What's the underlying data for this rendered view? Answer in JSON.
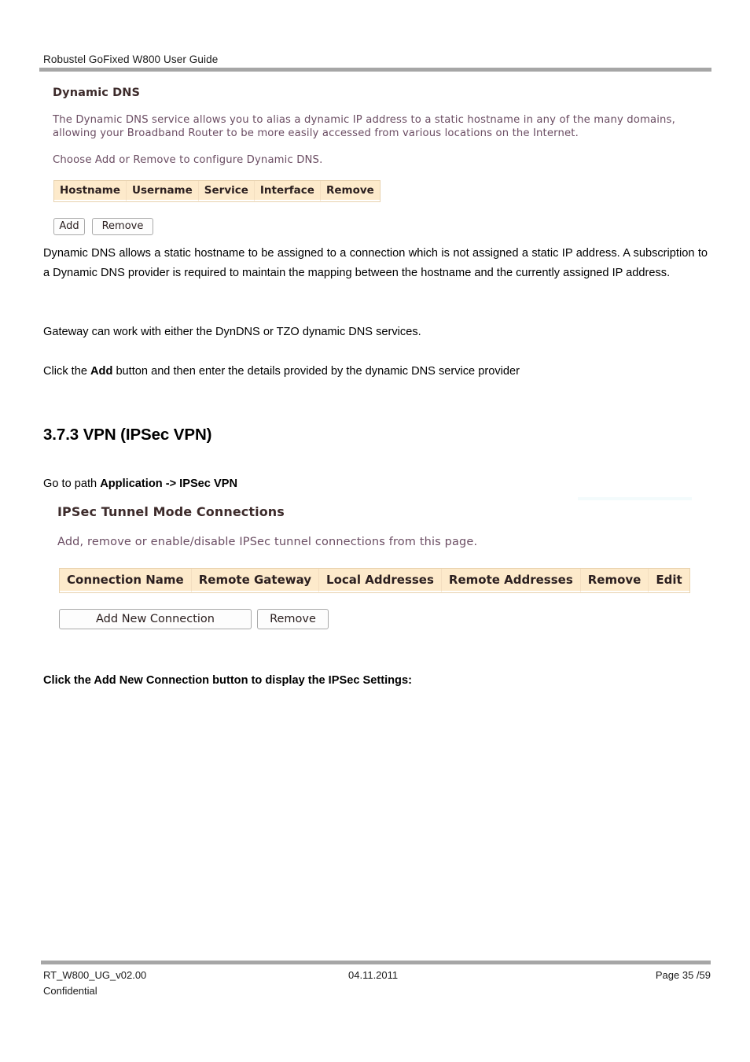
{
  "document": {
    "running_header": "Robustel GoFixed W800 User Guide"
  },
  "ddns_screenshot": {
    "title": "Dynamic DNS",
    "description_line1": "The Dynamic DNS service allows you to alias a dynamic IP address to a static hostname in any of the many domains,",
    "description_line2": "allowing your Broadband Router to be more easily accessed from various locations on the Internet.",
    "instruction": "Choose Add or Remove to configure Dynamic DNS.",
    "table_headers": [
      "Hostname",
      "Username",
      "Service",
      "Interface",
      "Remove"
    ],
    "buttons": [
      "Add",
      "Remove"
    ]
  },
  "body": {
    "paragraph_1_pre": "Dynamic DNS allows a static hostname to be assigned to a connection which is not assigned a static IP address. A subscription to a Dynamic DNS provider is required to maintain the mapping between the hostname and the currently assigned IP address.",
    "paragraph_2": "Gateway can work with either the DynDNS or TZO dynamic DNS services.",
    "paragraph_3_pre": "Click the ",
    "paragraph_3_bold": "Add",
    "paragraph_3_post": " button and then enter the details provided by the dynamic DNS service provider",
    "heading_373": "3.7.3 VPN (IPSec VPN)",
    "goto_pre": "Go to path ",
    "goto_bold": "Application -> IPSec VPN",
    "caption_bold": "Click the Add New Connection button to display the IPSec Settings:"
  },
  "ipsec_screenshot": {
    "title": "IPSec Tunnel Mode Connections",
    "description": "Add, remove or enable/disable IPSec tunnel connections from this page.",
    "table_headers": [
      "Connection Name",
      "Remote Gateway",
      "Local Addresses",
      "Remote Addresses",
      "Remove",
      "Edit"
    ],
    "buttons": [
      "Add New Connection",
      "Remove"
    ]
  },
  "footer": {
    "doc_id": "RT_W800_UG_v02.00",
    "date": "04.11.2011",
    "page": "Page 35 /59",
    "classification": "Confidential"
  },
  "colors": {
    "rule_gray": "#a6a6a6",
    "table_header_bg": "#fdeacb",
    "ui_text_purple": "#6b4d63"
  }
}
